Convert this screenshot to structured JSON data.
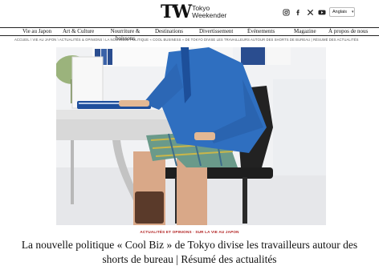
{
  "header": {
    "logo_mark": "TW",
    "logo_line1": "Tokyo",
    "logo_line2": "Weekender",
    "social_icons": [
      "instagram-icon",
      "facebook-icon",
      "x-icon",
      "youtube-icon"
    ],
    "language": "Anglais"
  },
  "nav": {
    "items": [
      "Vie au Japon",
      "Art & Culture",
      "Nourriture & boissons",
      "Destinations",
      "Divertissement",
      "Événements",
      "Magazine",
      "À propos de nous"
    ]
  },
  "breadcrumb": "ACCUEIL \\ VIE AU JAPON \\ ACTUALITÉS & OPINIONS \\ LA NOUVELLE POLITIQUE « COOL BUSINESS » DE TOKYO DIVISE LES TRAVAILLEURS AUTOUR DES SHORTS DE BUREAU | RÉSUMÉ DES ACTUALITÉS",
  "article": {
    "category": "ACTUALITÉS ET OPINIONS · SUR LA VIE AU JAPON",
    "title": "La nouvelle politique « Cool Biz » de Tokyo divise les travailleurs autour des shorts de bureau | Résumé des actualités"
  },
  "colors": {
    "accent": "#b01f1f",
    "suit": "#2f6fc0",
    "nav_rule": "#222222"
  }
}
